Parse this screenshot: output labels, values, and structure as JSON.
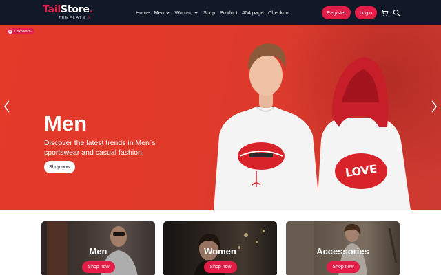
{
  "brand": {
    "name_a": "Tail",
    "name_b": "Store",
    "dot": ".",
    "sub": "TEMPLATE",
    "sub_mark": "X"
  },
  "nav": {
    "items": [
      {
        "label": "Home",
        "has_dropdown": false
      },
      {
        "label": "Men",
        "has_dropdown": true
      },
      {
        "label": "Women",
        "has_dropdown": true
      },
      {
        "label": "Shop",
        "has_dropdown": false
      },
      {
        "label": "Product",
        "has_dropdown": false
      },
      {
        "label": "404 page",
        "has_dropdown": false
      },
      {
        "label": "Checkout",
        "has_dropdown": false
      }
    ],
    "register_label": "Register",
    "login_label": "Login",
    "icons": [
      "cart-icon",
      "search-icon"
    ]
  },
  "hero": {
    "save_label": "Сохранить",
    "save_icon": "pinterest-icon",
    "title": "Men",
    "description": "Discover the latest trends in Men`s sportswear and casual fashion.",
    "button_label": "Shop now",
    "tshirt_text": "LOVE"
  },
  "categories": [
    {
      "title": "Men",
      "button_label": "Shop now"
    },
    {
      "title": "Women",
      "button_label": "Shop now"
    },
    {
      "title": "Accessories",
      "button_label": "Shop now"
    }
  ],
  "colors": {
    "nav_bg": "#111827",
    "accent": "#e11d48",
    "hero_bg": "#e03a2b"
  }
}
